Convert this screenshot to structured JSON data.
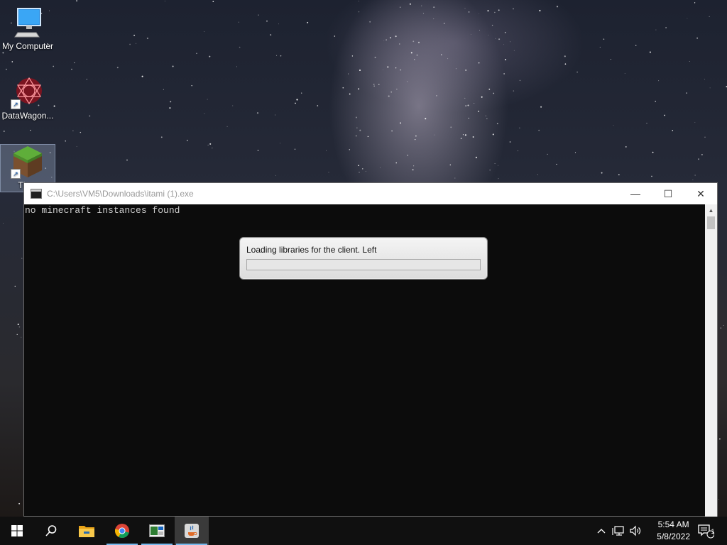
{
  "desktop": {
    "icons": [
      {
        "label": "My Computer",
        "icon": "computer-icon"
      },
      {
        "label": "DataWagon...",
        "icon": "datawagon-icon"
      },
      {
        "label": "TLau",
        "icon": "minecraft-grass-block-icon"
      }
    ]
  },
  "window": {
    "title": "C:\\Users\\VM5\\Downloads\\itami (1).exe",
    "console_output": "no minecraft instances found",
    "buttons": {
      "minimize": "—",
      "maximize": "☐",
      "close": "✕"
    }
  },
  "dialog": {
    "message": "Loading libraries for the client. Left",
    "progress": 0
  },
  "taskbar": {
    "items": [
      "start-icon",
      "search-icon",
      "file-explorer-icon",
      "chrome-icon",
      "app-window-icon",
      "java-icon"
    ],
    "tray": {
      "time": "5:54 AM",
      "date": "5/8/2022",
      "notification_count": "1"
    }
  },
  "colors": {
    "console_bg": "#0c0c0c",
    "console_text": "#cccccc",
    "taskbar_bg": "#101010",
    "accent": "#76b9ed"
  }
}
